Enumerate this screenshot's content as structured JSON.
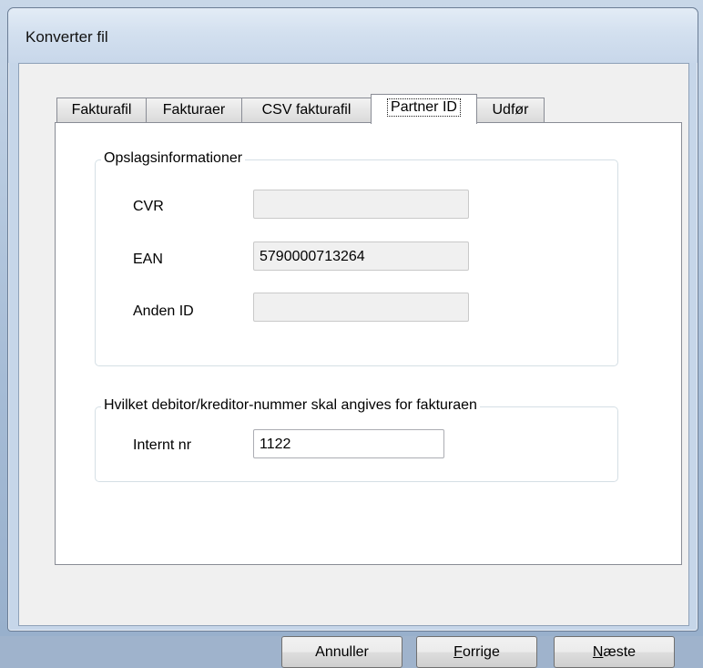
{
  "window": {
    "title": "Konverter fil"
  },
  "tabs": [
    {
      "label": "Fakturafil"
    },
    {
      "label": "Fakturaer"
    },
    {
      "label": "CSV fakturafil"
    },
    {
      "label": "Partner ID",
      "selected": true
    },
    {
      "label": "Udfør"
    }
  ],
  "lookup": {
    "legend": "Opslagsinformationer",
    "cvr_label": "CVR",
    "cvr_value": "",
    "ean_label": "EAN",
    "ean_value": "5790000713264",
    "other_label": "Anden ID",
    "other_value": ""
  },
  "debtor": {
    "legend": "Hvilket debitor/kreditor-nummer skal angives for fakturaen",
    "internal_label": "Internt nr",
    "internal_value": "1122"
  },
  "buttons": {
    "cancel": "Annuller",
    "prev_first": "F",
    "prev_rest": "orrige",
    "next_first": "N",
    "next_rest": "æste"
  }
}
